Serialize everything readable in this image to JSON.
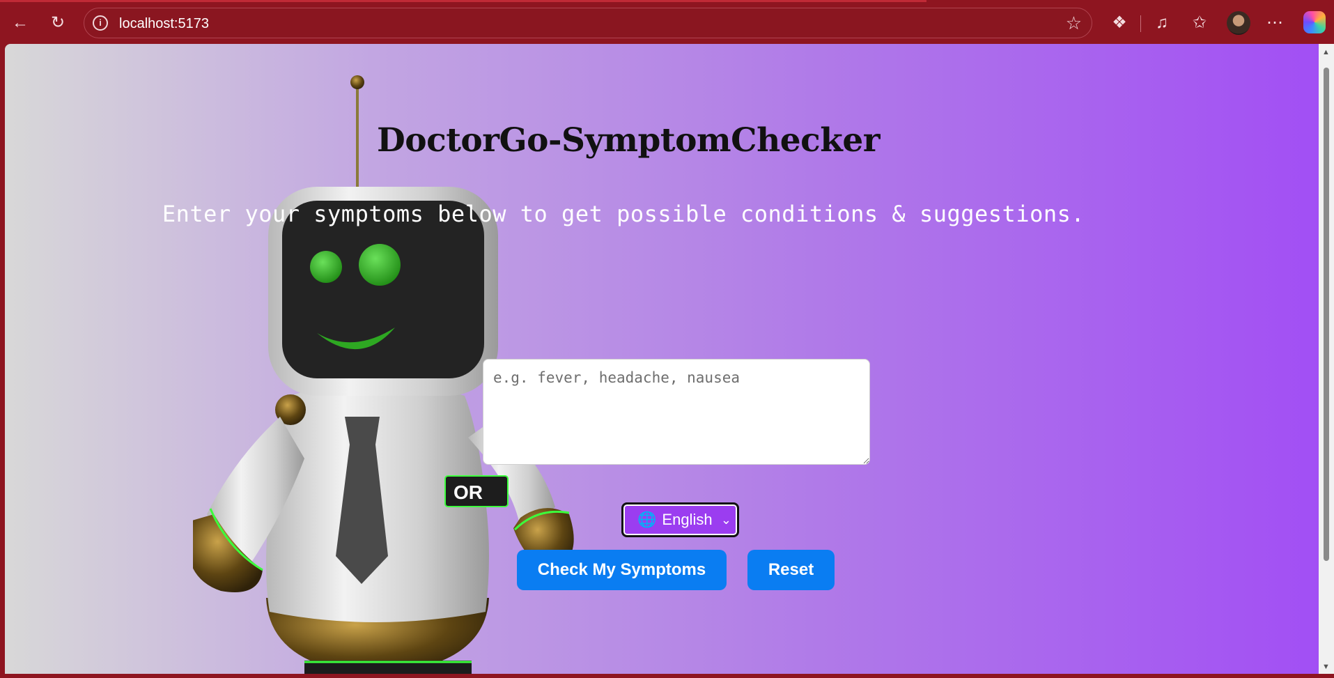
{
  "browser": {
    "url": "localhost:5173"
  },
  "page": {
    "title": "DoctorGo-SymptomChecker",
    "subtitle": "Enter your symptoms below to get possible conditions & suggestions.",
    "symptoms_placeholder": "e.g. fever, headache, nausea",
    "language_selected": "English",
    "check_button": "Check My Symptoms",
    "reset_button": "Reset",
    "robot_badge_text": "OR"
  },
  "colors": {
    "chrome": "#8e1520",
    "button_blue": "#0a7df2",
    "language_purple": "#9b3df0",
    "gradient_start": "#d8d8d8",
    "gradient_end": "#a24ff4"
  }
}
